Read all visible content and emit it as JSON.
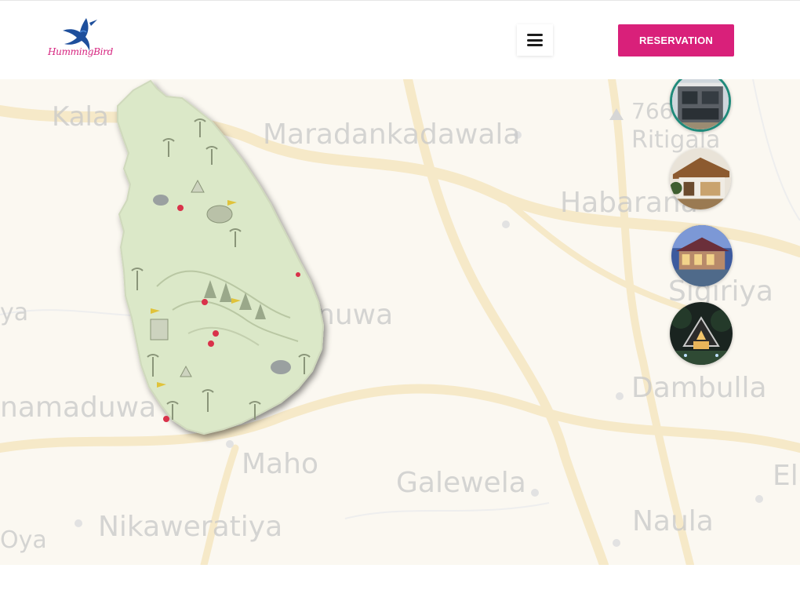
{
  "header": {
    "logo_text": "HummingBird",
    "logo_icon": "hummingbird-icon",
    "menu_icon": "hamburger-icon",
    "reservation_label": "RESERVATION"
  },
  "map": {
    "places": [
      {
        "name": "Kala Oya"
      },
      {
        "name": "Maradankadawala"
      },
      {
        "name": "766"
      },
      {
        "name": "Ritigala"
      },
      {
        "name": "Habarana"
      },
      {
        "name": "Sigiriya"
      },
      {
        "name": "nuwa"
      },
      {
        "name": "Dambulla"
      },
      {
        "name": "namaduwa"
      },
      {
        "name": "Maho"
      },
      {
        "name": "Galewela"
      },
      {
        "name": "Nikaweratiya"
      },
      {
        "name": "Naula"
      },
      {
        "name": "Oya"
      },
      {
        "name": "Ela"
      },
      {
        "name": "ya"
      }
    ],
    "island_icon": "sri-lanka-map-icon",
    "location_pins": 6
  },
  "properties": [
    {
      "name": "modern-villa",
      "active": true
    },
    {
      "name": "wooden-chalet",
      "active": false
    },
    {
      "name": "night-bungalow",
      "active": false
    },
    {
      "name": "forest-cabin",
      "active": false
    }
  ],
  "colors": {
    "brand_pink": "#d9207a",
    "logo_blue": "#1e4f9c",
    "active_ring": "#1f8a7a",
    "island_green": "#dbe8c8",
    "map_road": "#f5e7c4"
  }
}
